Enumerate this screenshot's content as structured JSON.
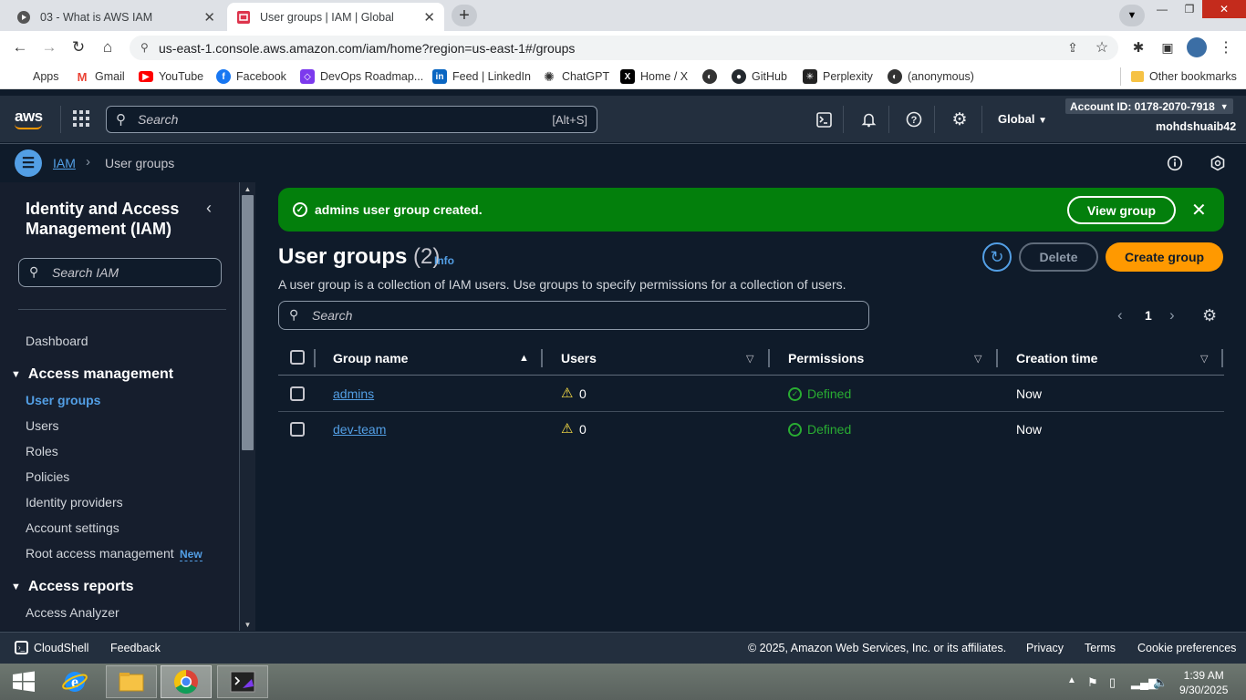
{
  "browser": {
    "tabs": [
      {
        "title": "03 - What is AWS IAM",
        "active": false
      },
      {
        "title": "User groups | IAM | Global",
        "active": true
      }
    ],
    "url": "us-east-1.console.aws.amazon.com/iam/home?region=us-east-1#/groups",
    "bookmarks": [
      {
        "label": "Apps",
        "icon": "apps-grid-icon",
        "color": "#d93025"
      },
      {
        "label": "Gmail",
        "icon": "gmail-icon",
        "color": "#ea4335"
      },
      {
        "label": "YouTube",
        "icon": "youtube-icon",
        "color": "#ff0000"
      },
      {
        "label": "Facebook",
        "icon": "facebook-icon",
        "color": "#1877f2"
      },
      {
        "label": "DevOps Roadmap...",
        "icon": "devops-icon",
        "color": "#7c3aed"
      },
      {
        "label": "Feed | LinkedIn",
        "icon": "linkedin-icon",
        "color": "#0a66c2"
      },
      {
        "label": "ChatGPT",
        "icon": "chatgpt-icon",
        "color": "#333333"
      },
      {
        "label": "Home / X",
        "icon": "x-icon",
        "color": "#000000"
      },
      {
        "label": "",
        "icon": "globe-icon",
        "color": "#333333"
      },
      {
        "label": "GitHub",
        "icon": "github-icon",
        "color": "#24292e"
      },
      {
        "label": "Perplexity",
        "icon": "perplexity-icon",
        "color": "#222222"
      },
      {
        "label": "(anonymous)",
        "icon": "globe-icon",
        "color": "#333333"
      }
    ],
    "other_bookmarks": "Other bookmarks"
  },
  "aws_nav": {
    "search_placeholder": "Search",
    "search_shortcut": "[Alt+S]",
    "region": "Global",
    "account_id": "Account ID: 0178-2070-7918",
    "username": "mohdshuaib42"
  },
  "breadcrumb": {
    "root": "IAM",
    "current": "User groups"
  },
  "sidebar": {
    "title": "Identity and Access Management (IAM)",
    "search_placeholder": "Search IAM",
    "dashboard": "Dashboard",
    "section_access_management": "Access management",
    "items": [
      {
        "label": "User groups",
        "active": true
      },
      {
        "label": "Users",
        "active": false
      },
      {
        "label": "Roles",
        "active": false
      },
      {
        "label": "Policies",
        "active": false
      },
      {
        "label": "Identity providers",
        "active": false
      },
      {
        "label": "Account settings",
        "active": false
      },
      {
        "label": "Root access management",
        "active": false
      }
    ],
    "new_badge": "New",
    "section_access_reports": "Access reports",
    "access_analyzer": "Access Analyzer"
  },
  "flash": {
    "message": "admins user group created.",
    "view_button": "View group"
  },
  "main": {
    "title": "User groups",
    "count": "(2)",
    "info": "Info",
    "description": "A user group is a collection of IAM users. Use groups to specify permissions for a collection of users.",
    "delete_button": "Delete",
    "create_button": "Create group",
    "search_placeholder": "Search",
    "page": "1"
  },
  "table": {
    "columns": [
      "Group name",
      "Users",
      "Permissions",
      "Creation time"
    ],
    "rows": [
      {
        "group": "admins",
        "users": "0",
        "permissions": "Defined",
        "created": "Now"
      },
      {
        "group": "dev-team",
        "users": "0",
        "permissions": "Defined",
        "created": "Now"
      }
    ]
  },
  "footer": {
    "cloudshell": "CloudShell",
    "feedback": "Feedback",
    "copyright": "© 2025, Amazon Web Services, Inc. or its affiliates.",
    "privacy": "Privacy",
    "terms": "Terms",
    "cookies": "Cookie preferences"
  },
  "taskbar": {
    "time": "1:39 AM",
    "date": "9/30/2025"
  },
  "colors": {
    "accent_blue": "#539fe5",
    "success_green": "#037f0c",
    "primary_orange": "#ff9900",
    "aws_nav": "#232f3e"
  }
}
